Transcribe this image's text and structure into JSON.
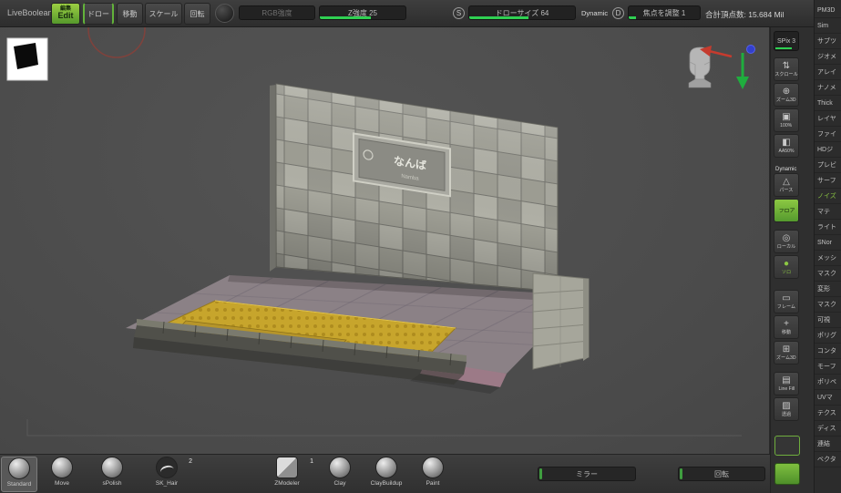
{
  "colors": {
    "accent_green": "#6fae3e",
    "slider_green": "#2fd052",
    "gizmo_red": "#c53b2e",
    "gizmo_green": "#1fae3e",
    "gizmo_blue": "#3340cc",
    "paving_yellow": "#c7a52c"
  },
  "top_toolbar": {
    "live_boolean": "LiveBoolean",
    "edit_sub": "編集",
    "edit": "Edit",
    "draw": "ドロー",
    "move": "移動",
    "scale": "スケール",
    "rotate": "回転",
    "rgb_intensity": "RGB強度",
    "z_intensity": "Z強度 25",
    "stroke_badge": "S",
    "draw_size": "ドローサイズ 64",
    "dynamic": "Dynamic",
    "focal_badge": "D",
    "focal_shift": "焦点を調整 1",
    "total_points": "合計頂点数: 15.684 Mil"
  },
  "canvas": {
    "plaque_title": "なんば",
    "plaque_subtitle": "Namba"
  },
  "right_shelf": {
    "spix": {
      "label": "SPix",
      "value": "3"
    },
    "items": [
      {
        "label": "スクロール",
        "glyph": "⇅"
      },
      {
        "label": "ズーム3D",
        "glyph": "⊕"
      },
      {
        "label": "100%",
        "glyph": "▣"
      },
      {
        "label": "AA50%",
        "glyph": "◧"
      },
      {
        "label": "パース",
        "glyph": "△",
        "tag": "Dynamic"
      },
      {
        "label": "フロア"
      },
      {
        "label": "ローカル",
        "glyph": "◎"
      },
      {
        "label": "ソロ",
        "glyph": "●"
      },
      {
        "label": "フレーム",
        "glyph": "▭"
      },
      {
        "label": "移動",
        "glyph": "+"
      },
      {
        "label": "ズーム3D",
        "glyph": "⊞"
      },
      {
        "label": "Line Fill",
        "glyph": "▤"
      },
      {
        "label": "透過",
        "glyph": "▨"
      }
    ]
  },
  "tool_panel": {
    "items": [
      "PM3D",
      "Sim",
      "サブツ",
      "ジオメ",
      "アレイ",
      "ナノメ",
      "Thick",
      "レイヤ",
      "ファイ",
      "HDジ",
      "プレビ",
      "サーフ",
      "ノイズ",
      "マテ",
      "ライト",
      "SNor",
      "メッシ",
      "マスク",
      "変形",
      "マスク",
      "可視",
      "ポリグ",
      "コンタ",
      "モーフ",
      "ポリペ",
      "UVマ",
      "テクス",
      "ディス",
      "連結",
      "ベクタ"
    ]
  },
  "brush_bar": {
    "brushes": [
      {
        "name": "Standard"
      },
      {
        "name": "Move"
      },
      {
        "name": "sPolish"
      },
      {
        "name": "SK_Hair",
        "badge": "2"
      },
      {
        "name": "ZModeler",
        "badge": "1"
      },
      {
        "name": "Clay"
      },
      {
        "name": "ClayBuildup"
      },
      {
        "name": "Paint"
      }
    ],
    "mirror": "ミラー",
    "rotate": "回転"
  }
}
